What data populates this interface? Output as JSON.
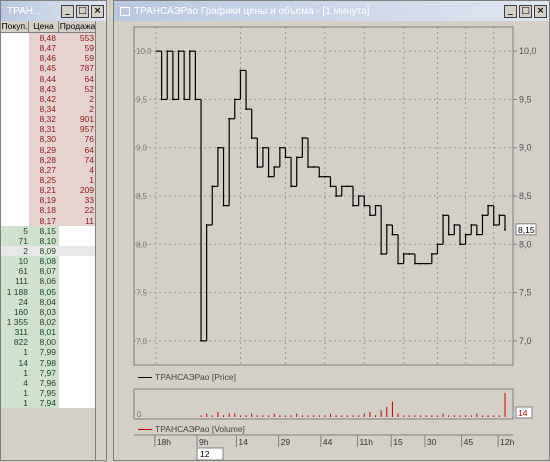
{
  "orderbook": {
    "title": "ТРАН...",
    "columns": [
      "Покуп.",
      "Цена",
      "Продажа"
    ],
    "asks": [
      {
        "price": "8,48",
        "qty": "553"
      },
      {
        "price": "8,47",
        "qty": "59"
      },
      {
        "price": "8,46",
        "qty": "59"
      },
      {
        "price": "8,45",
        "qty": "787"
      },
      {
        "price": "8,44",
        "qty": "64"
      },
      {
        "price": "8,43",
        "qty": "52"
      },
      {
        "price": "8,42",
        "qty": "2"
      },
      {
        "price": "8,34",
        "qty": "2"
      },
      {
        "price": "8,32",
        "qty": "901"
      },
      {
        "price": "8,31",
        "qty": "957"
      },
      {
        "price": "8,30",
        "qty": "76"
      },
      {
        "price": "8,29",
        "qty": "64"
      },
      {
        "price": "8,28",
        "qty": "74"
      },
      {
        "price": "8,27",
        "qty": "4"
      },
      {
        "price": "8,25",
        "qty": "1"
      },
      {
        "price": "8,21",
        "qty": "209"
      },
      {
        "price": "8,19",
        "qty": "33"
      },
      {
        "price": "8,18",
        "qty": "22"
      },
      {
        "price": "8,17",
        "qty": "11"
      }
    ],
    "bids": [
      {
        "qty": "5",
        "price": "8,15"
      },
      {
        "qty": "71",
        "price": "8,10"
      },
      {
        "qty": "2",
        "price": "8,09"
      },
      {
        "qty": "10",
        "price": "8,08"
      },
      {
        "qty": "61",
        "price": "8,07"
      },
      {
        "qty": "111",
        "price": "8,06"
      },
      {
        "qty": "1 188",
        "price": "8,05"
      },
      {
        "qty": "24",
        "price": "8,04"
      },
      {
        "qty": "160",
        "price": "8,03"
      },
      {
        "qty": "1 355",
        "price": "8,02"
      },
      {
        "qty": "311",
        "price": "8,01"
      },
      {
        "qty": "822",
        "price": "8,00"
      },
      {
        "qty": "1",
        "price": "7,99"
      },
      {
        "qty": "14",
        "price": "7,98"
      },
      {
        "qty": "1",
        "price": "7,97"
      },
      {
        "qty": "4",
        "price": "7,96"
      },
      {
        "qty": "1",
        "price": "7,95"
      },
      {
        "qty": "1",
        "price": "7,94"
      }
    ]
  },
  "chart_window": {
    "title": "ТРАНСАЭРао Графики цены и объема - [1 минута]",
    "price_legend": "ТРАНСАЭРао [Price]",
    "volume_legend": "ТРАНСАЭРао [Volume]",
    "last_price_label": "8,15",
    "last_volume_label": "14",
    "time_labels": [
      "18h",
      "9h",
      "14",
      "29",
      "44",
      "11h",
      "15",
      "30",
      "45",
      "12h"
    ],
    "cursor_label": "12",
    "price_color": "#000000",
    "volume_color": "#cc0000"
  },
  "chart_data": {
    "type": "line",
    "title": "",
    "ylabel": "",
    "ylim": [
      6.75,
      10.25
    ],
    "yticks": [
      "7,0",
      "7,5",
      "8,0",
      "8,5",
      "9,0",
      "9,5",
      "10,0"
    ],
    "grid": true,
    "series": [
      {
        "name": "ТРАНСАЭРао [Price]",
        "values": [
          10.0,
          9.5,
          10.0,
          9.5,
          10.0,
          9.5,
          10.0,
          9.5,
          7.0,
          8.2,
          8.6,
          9.0,
          8.4,
          9.3,
          9.5,
          9.8,
          9.4,
          9.1,
          8.8,
          9.0,
          8.7,
          8.8,
          9.0,
          8.9,
          8.6,
          8.9,
          9.1,
          8.8,
          8.8,
          8.7,
          8.7,
          8.6,
          8.5,
          8.6,
          8.6,
          8.4,
          8.5,
          8.4,
          8.3,
          8.4,
          7.9,
          8.2,
          8.1,
          7.8,
          7.9,
          7.9,
          7.8,
          7.8,
          7.8,
          7.9,
          8.0,
          8.3,
          8.1,
          8.2,
          8.0,
          8.1,
          8.2,
          8.1,
          8.3,
          8.4,
          8.2,
          8.3,
          8.15
        ]
      },
      {
        "name": "ТРАНСАЭРао [Volume]",
        "values": [
          0,
          0,
          0,
          0,
          0,
          0,
          0,
          0,
          1,
          2,
          1,
          3,
          1,
          2,
          2,
          1,
          1,
          2,
          1,
          1,
          1,
          2,
          1,
          1,
          1,
          2,
          1,
          1,
          1,
          1,
          1,
          2,
          1,
          1,
          1,
          1,
          1,
          2,
          3,
          1,
          4,
          6,
          9,
          2,
          1,
          1,
          1,
          1,
          1,
          1,
          1,
          2,
          1,
          1,
          1,
          1,
          1,
          2,
          1,
          1,
          1,
          1,
          14
        ]
      }
    ],
    "volume_ylim": [
      0,
      14
    ]
  }
}
